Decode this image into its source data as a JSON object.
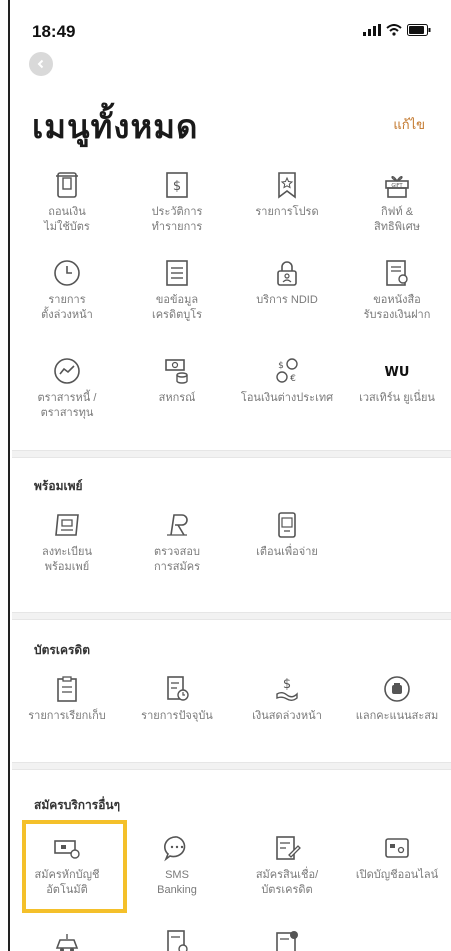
{
  "status_bar": {
    "time": "18:49"
  },
  "header": {
    "title": "เมนูทั้งหมด",
    "edit_label": "แก้ไข"
  },
  "menu": {
    "items": [
      {
        "label": "ถอนเงิน\nไม่ใช้บัตร",
        "icon": "atm-card-icon"
      },
      {
        "label": "ประวัติการ\nทำรายการ",
        "icon": "receipt-dollar-icon"
      },
      {
        "label": "รายการโปรด",
        "icon": "bookmark-star-icon"
      },
      {
        "label": "กิฟท์ &\nสิทธิพิเศษ",
        "icon": "gift-icon"
      },
      {
        "label": "รายการ\nตั้งล่วงหน้า",
        "icon": "clock-icon"
      },
      {
        "label": "ขอข้อมูล\nเครดิตบูโร",
        "icon": "document-list-icon"
      },
      {
        "label": "บริการ NDID",
        "icon": "id-lock-icon"
      },
      {
        "label": "ขอหนังสือ\nรับรองเงินฝาก",
        "icon": "certificate-icon"
      },
      {
        "label": "ตราสารหนี้ /\nตราสารทุน",
        "icon": "chart-circle-icon"
      },
      {
        "label": "สหกรณ์",
        "icon": "coop-money-icon"
      },
      {
        "label": "โอนเงินต่างประเทศ",
        "icon": "fx-transfer-icon"
      },
      {
        "label": "เวสเทิร์น ยูเนี่ยน",
        "icon": "western-union-icon",
        "icon_text": "WU"
      }
    ]
  },
  "promptpay": {
    "title": "พร้อมเพย์",
    "items": [
      {
        "label": "ลงทะเบียน\nพร้อมเพย์",
        "icon": "promptpay-register-icon"
      },
      {
        "label": "ตรวจสอบ\nการสมัคร",
        "icon": "promptpay-check-icon"
      },
      {
        "label": "เตือนเพื่อจ่าย",
        "icon": "payment-reminder-icon"
      }
    ]
  },
  "credit_card": {
    "title": "บัตรเครดิต",
    "items": [
      {
        "label": "รายการเรียกเก็บ",
        "icon": "clipboard-icon"
      },
      {
        "label": "รายการปัจจุบัน",
        "icon": "current-statement-icon"
      },
      {
        "label": "เงินสดล่วงหน้า",
        "icon": "cash-advance-icon"
      },
      {
        "label": "แลกคะแนนสะสม",
        "icon": "redeem-points-icon"
      }
    ]
  },
  "other_services": {
    "title": "สมัครบริการอื่นๆ",
    "items": [
      {
        "label": "สมัครหักบัญชี\nอัตโนมัติ",
        "icon": "auto-debit-icon"
      },
      {
        "label": "SMS\nBanking",
        "icon": "sms-chat-icon"
      },
      {
        "label": "สมัครสินเชื่อ/\nบัตรเครดิต",
        "icon": "loan-apply-icon"
      },
      {
        "label": "เปิดบัญชีออนไลน์",
        "icon": "open-account-icon"
      }
    ],
    "partial_row_icons": [
      "car-icon",
      "document-clock-icon",
      "document-gear-icon"
    ]
  },
  "colors": {
    "accent_edit": "#c2762a",
    "highlight": "#f4c02a",
    "icon_stroke": "#555555"
  }
}
